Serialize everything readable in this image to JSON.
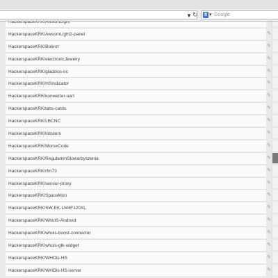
{
  "toolbar": {
    "search_placeholder": "Google",
    "search_engine_badge": "8",
    "dropdown_icon": "triangle-down-icon",
    "reload_icon": "reload-icon"
  },
  "repos": [
    "HackerspaceKRK/AwsomLight",
    "HackerspaceKRK/AwsomLight2-panel",
    "HackerspaceKRK/Bobrot",
    "HackerspaceKRK/electronicJewelry",
    "HackerspaceKRK/gladzios-irc",
    "HackerspaceKRK/HSIndicator",
    "HackerspaceKRK/konwerter-uart",
    "HackerspaceKRK/labs-cards",
    "HackerspaceKRK/LBCNC",
    "HackerspaceKRK/lobsters",
    "HackerspaceKRK/MorseCode",
    "HackerspaceKRK/RegulaminStowarzyszenia",
    "HackerspaceKRK/rfm73",
    "HackerspaceKRK/sensor-proxy",
    "HackerspaceKRK/SpaceMon",
    "HackerspaceKRK/SW-EK-LM4F120XL",
    "HackerspaceKRK/WhoIS-Android",
    "HackerspaceKRK/whois-boost-connector",
    "HackerspaceKRK/whois-gtk-widget",
    "HackerspaceKRK/WHOis-HS",
    "HackerspaceKRK/WHOis-HS-server"
  ],
  "highlighted_index": 11,
  "edit_icon": "pencil-icon"
}
